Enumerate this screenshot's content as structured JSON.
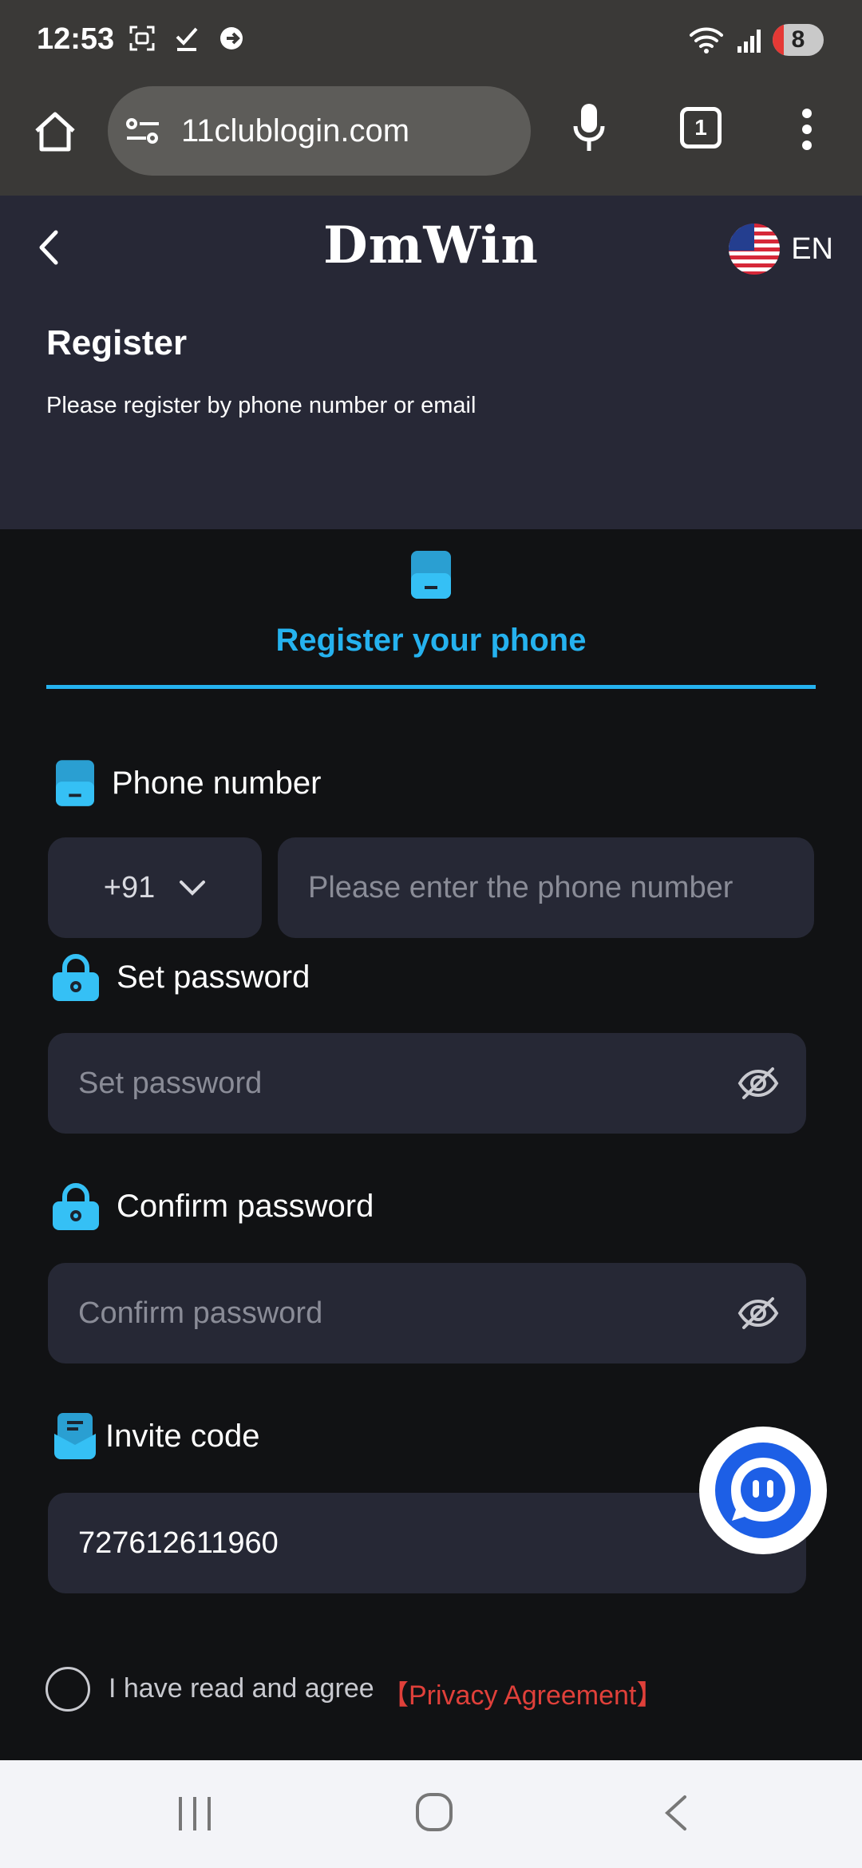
{
  "status": {
    "time": "12:53",
    "battery": "8"
  },
  "browser": {
    "url": "11clublogin.com",
    "tab_count": "1"
  },
  "header": {
    "brand": "DmWin",
    "language": "EN",
    "title": "Register",
    "subtitle": "Please register by phone number or email"
  },
  "tab": {
    "label": "Register your phone"
  },
  "form": {
    "phone_label": "Phone number",
    "country_code": "+91",
    "phone_placeholder": "Please enter the phone number",
    "password_label": "Set password",
    "password_placeholder": "Set password",
    "confirm_label": "Confirm password",
    "confirm_placeholder": "Confirm password",
    "invite_label": "Invite code",
    "invite_value": "727612611960",
    "agree_text": "I have read and agree",
    "privacy_link": "【Privacy Agreement】"
  },
  "colors": {
    "accent": "#25b2ef",
    "link": "#e0403a",
    "header_bg": "#272836",
    "page_bg": "#111214",
    "input_bg": "#262835"
  },
  "icons": [
    "home-icon",
    "site-settings-icon",
    "mic-icon",
    "tabs-icon",
    "more-icon",
    "back-chevron-icon",
    "us-flag-icon",
    "phone-icon",
    "lock-icon",
    "eye-off-icon",
    "invite-icon",
    "chat-bot-icon"
  ]
}
